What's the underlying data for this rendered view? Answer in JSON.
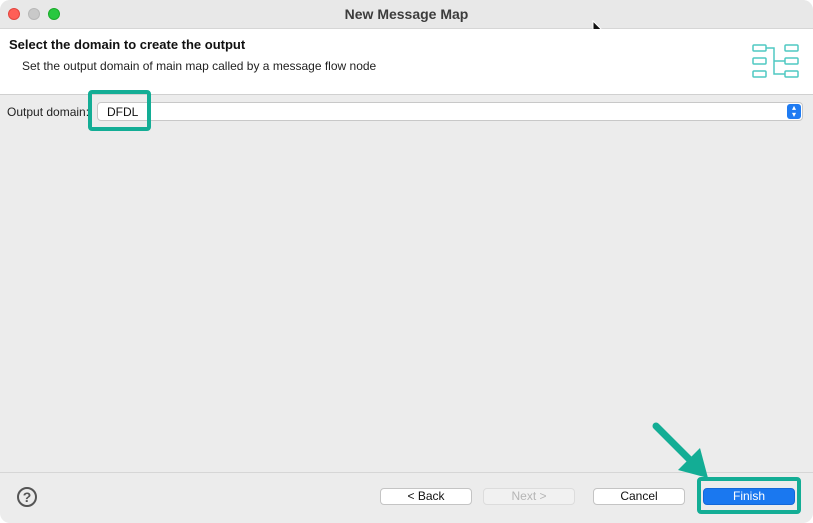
{
  "window": {
    "title": "New Message Map"
  },
  "header": {
    "title": "Select the domain to create the output",
    "description": "Set the output domain of main map called by a message flow node",
    "icon": "map-structure-icon"
  },
  "form": {
    "output_domain_label": "Output domain:",
    "output_domain_value": "DFDL"
  },
  "footer": {
    "help_icon": "?",
    "back_label": "< Back",
    "next_label": "Next >",
    "cancel_label": "Cancel",
    "finish_label": "Finish"
  },
  "colors": {
    "accent": "#1a78f0",
    "annotation": "#13ad95"
  }
}
